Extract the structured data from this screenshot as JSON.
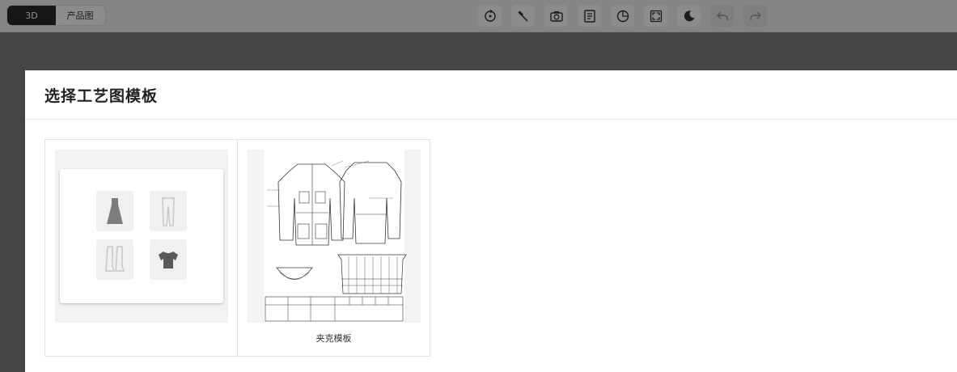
{
  "toolbar": {
    "view_modes": [
      {
        "label": "3D",
        "active": true
      },
      {
        "label": "产品图",
        "active": false
      }
    ],
    "tools": [
      {
        "icon": "rotate-icon"
      },
      {
        "icon": "wrench-icon"
      },
      {
        "icon": "camera-icon"
      },
      {
        "icon": "document-icon"
      },
      {
        "icon": "palette-icon"
      },
      {
        "icon": "fullscreen-icon"
      },
      {
        "icon": "moon-icon"
      },
      {
        "icon": "undo-icon",
        "disabled": true
      },
      {
        "icon": "redo-icon",
        "disabled": true
      }
    ]
  },
  "modal": {
    "title": "选择工艺图模板",
    "templates": [
      {
        "label": "",
        "thumbnail": "blank-template"
      },
      {
        "label": "夹克模板",
        "thumbnail": "jacket-tech-drawing"
      }
    ]
  }
}
